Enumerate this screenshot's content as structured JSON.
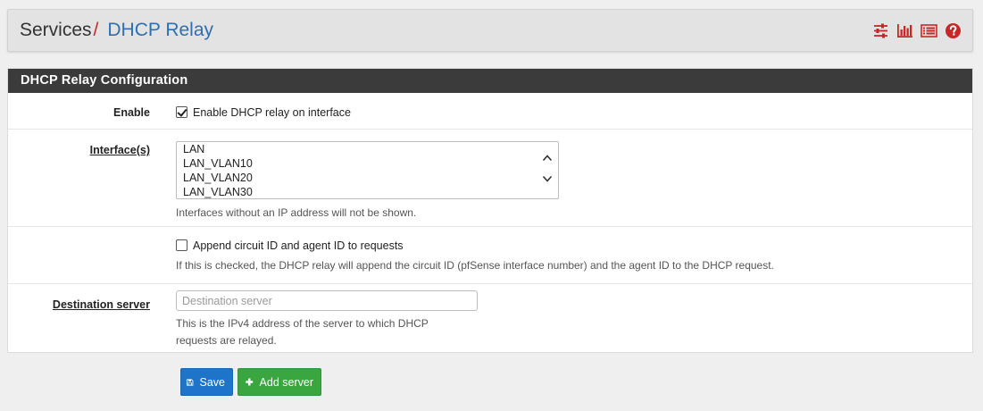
{
  "breadcrumb": {
    "root": "Services",
    "separator": "/",
    "current": "DHCP Relay"
  },
  "header_icons": [
    "settings-sliders-icon",
    "bar-chart-icon",
    "list-icon",
    "help-icon"
  ],
  "accent_colors": {
    "brand_red": "#c62828",
    "link_blue": "#2f6fb0",
    "save_blue": "#1e74c9",
    "add_green": "#3aa63f"
  },
  "panel": {
    "title": "DHCP Relay Configuration"
  },
  "enable": {
    "label": "Enable",
    "checkbox_label": "Enable DHCP relay on interface",
    "checked": true
  },
  "interfaces": {
    "label": "Interface(s)",
    "options": [
      "LAN",
      "LAN_VLAN10",
      "LAN_VLAN20",
      "LAN_VLAN30"
    ],
    "help": "Interfaces without an IP address will not be shown."
  },
  "append": {
    "checkbox_label": "Append circuit ID and agent ID to requests",
    "checked": false,
    "help": "If this is checked, the DHCP relay will append the circuit ID (pfSense interface number) and the agent ID to the DHCP request."
  },
  "destination": {
    "label": "Destination server",
    "placeholder": "Destination server",
    "value": "",
    "help_line1": "This is the IPv4 address of the server to which DHCP",
    "help_line2": "requests are relayed."
  },
  "buttons": {
    "save": "Save",
    "add_server": "Add server"
  }
}
